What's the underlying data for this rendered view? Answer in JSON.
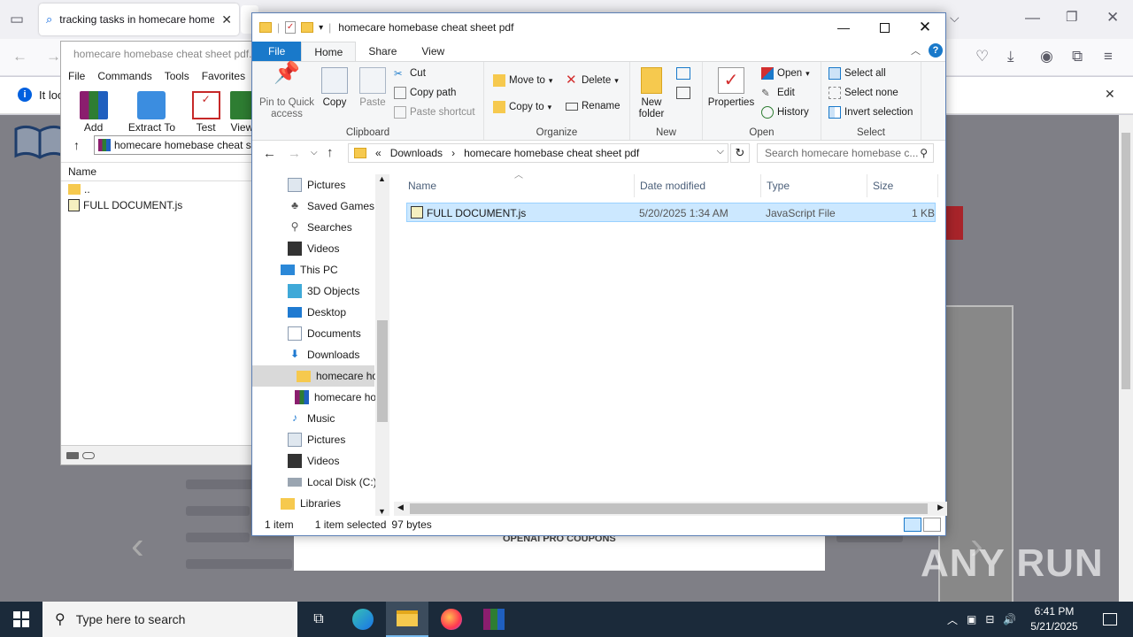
{
  "browser": {
    "tab_title": "tracking tasks in homecare homebase cheat sheet pdf",
    "notification_text": "It loo",
    "page_caption": "OPENAI PRO COUPONS"
  },
  "winrar": {
    "title": "homecare homebase cheat sheet pdf.zip",
    "menu": [
      "File",
      "Commands",
      "Tools",
      "Favorites"
    ],
    "tools": [
      "Add",
      "Extract To",
      "Test",
      "View"
    ],
    "path": "homecare homebase cheat sheet pdf.zip",
    "column_name": "Name",
    "rows": [
      "..",
      "FULL DOCUMENT.js"
    ]
  },
  "explorer": {
    "title": "homecare homebase cheat sheet pdf",
    "tabs": {
      "file": "File",
      "home": "Home",
      "share": "Share",
      "view": "View"
    },
    "ribbon": {
      "pin": "Pin to Quick access",
      "copy": "Copy",
      "paste": "Paste",
      "cut": "Cut",
      "copy_path": "Copy path",
      "paste_shortcut": "Paste shortcut",
      "clipboard": "Clipboard",
      "move_to": "Move to",
      "copy_to": "Copy to",
      "delete": "Delete",
      "rename": "Rename",
      "organize": "Organize",
      "new_folder": "New folder",
      "new": "New",
      "properties": "Properties",
      "open": "Open",
      "edit": "Edit",
      "history": "History",
      "open_group": "Open",
      "select_all": "Select all",
      "select_none": "Select none",
      "invert_selection": "Invert selection",
      "select": "Select"
    },
    "address": {
      "prefix": "«",
      "crumb1": "Downloads",
      "crumb2": "homecare homebase cheat sheet pdf",
      "search_placeholder": "Search homecare homebase c..."
    },
    "nav_items": [
      "Pictures",
      "Saved Games",
      "Searches",
      "Videos",
      "This PC",
      "3D Objects",
      "Desktop",
      "Documents",
      "Downloads",
      "homecare ho",
      "homecare ho",
      "Music",
      "Pictures",
      "Videos",
      "Local Disk (C:)",
      "Libraries"
    ],
    "columns": {
      "name": "Name",
      "date": "Date modified",
      "type": "Type",
      "size": "Size"
    },
    "file": {
      "name": "FULL DOCUMENT.js",
      "date": "5/20/2025 1:34 AM",
      "type": "JavaScript File",
      "size": "1 KB"
    },
    "status": {
      "count": "1 item",
      "selected": "1 item selected",
      "bytes": "97 bytes"
    }
  },
  "taskbar": {
    "search_placeholder": "Type here to search",
    "time": "6:41 PM",
    "date": "5/21/2025"
  },
  "watermark": "ANY RUN"
}
